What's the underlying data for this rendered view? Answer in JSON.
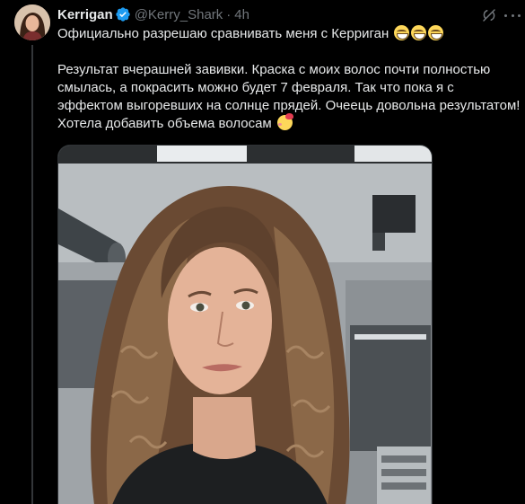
{
  "tweet": {
    "display_name": "Kerrigan",
    "handle": "@Kerry_Shark",
    "separator": "·",
    "time": "4h",
    "line1": "Официально разрешаю сравнивать меня с Керриган",
    "line2": "Результат вчерашней завивки. Краска с моих волос почти полностью смылась, а покрасить можно будет 7 февраля. Так что пока я с эффектом выгоревших на солнце прядей. Очеець довольна результатом! Хотела добавить объема волосам",
    "emojis_line1": [
      "grinning-face-icon",
      "grinning-face-icon",
      "grinning-face-icon"
    ],
    "emojis_line2": [
      "smiling-face-with-hearts-icon"
    ]
  },
  "colors": {
    "background": "#000000",
    "text": "#e7e9ea",
    "secondary": "#71767b",
    "verified": "#1d9bf0",
    "divider": "#333639"
  }
}
